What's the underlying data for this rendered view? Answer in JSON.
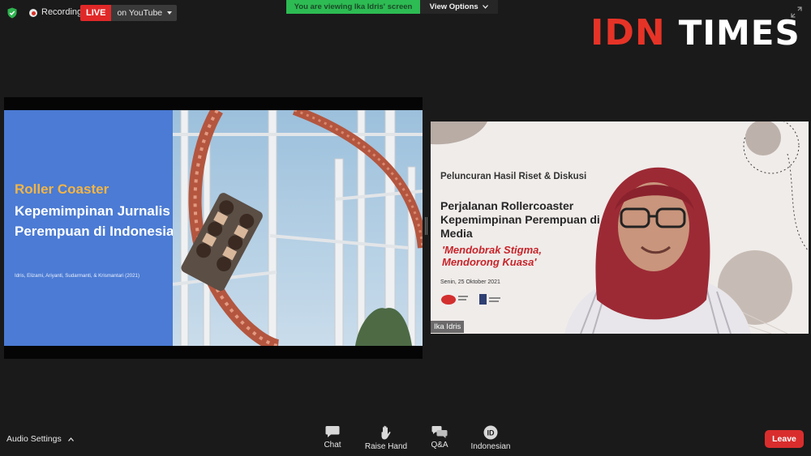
{
  "top_bar": {
    "recording_label": "Recording",
    "live_badge": "LIVE",
    "live_target": "on YouTube",
    "share_banner": "You are viewing Ika Idris' screen",
    "view_options": "View Options"
  },
  "logo": {
    "part1": "IDN",
    "part2": "TIMES"
  },
  "slide": {
    "title_line1": "Roller Coaster",
    "title_line2": "Kepemimpinan Jurnalis Perempuan di Indonesia",
    "authors": "Idris, Elizami, Ariyanti, Sudarmanti, & Krismantari (2021)"
  },
  "video": {
    "background_subtitle": "Peluncuran Hasil Riset & Diskusi",
    "background_title": "Perjalanan Rollercoaster Kepemimpinan Perempuan di Media",
    "background_tagline": "'Mendobrak Stigma, Mendorong Kuasa'",
    "background_date": "Senin, 25 Oktober 2021",
    "participant_name": "Ika Idris"
  },
  "toolbar": {
    "audio_settings": "Audio Settings",
    "chat": "Chat",
    "raise_hand": "Raise Hand",
    "qa": "Q&A",
    "language": "Indonesian",
    "language_badge": "ID",
    "leave": "Leave"
  },
  "colors": {
    "live_red": "#e02828",
    "share_green": "#2dbb53",
    "leave_red": "#d92d2d",
    "logo_red": "#e63327",
    "slide_blue": "#4b7bd4",
    "slide_accent": "#f4b544"
  }
}
